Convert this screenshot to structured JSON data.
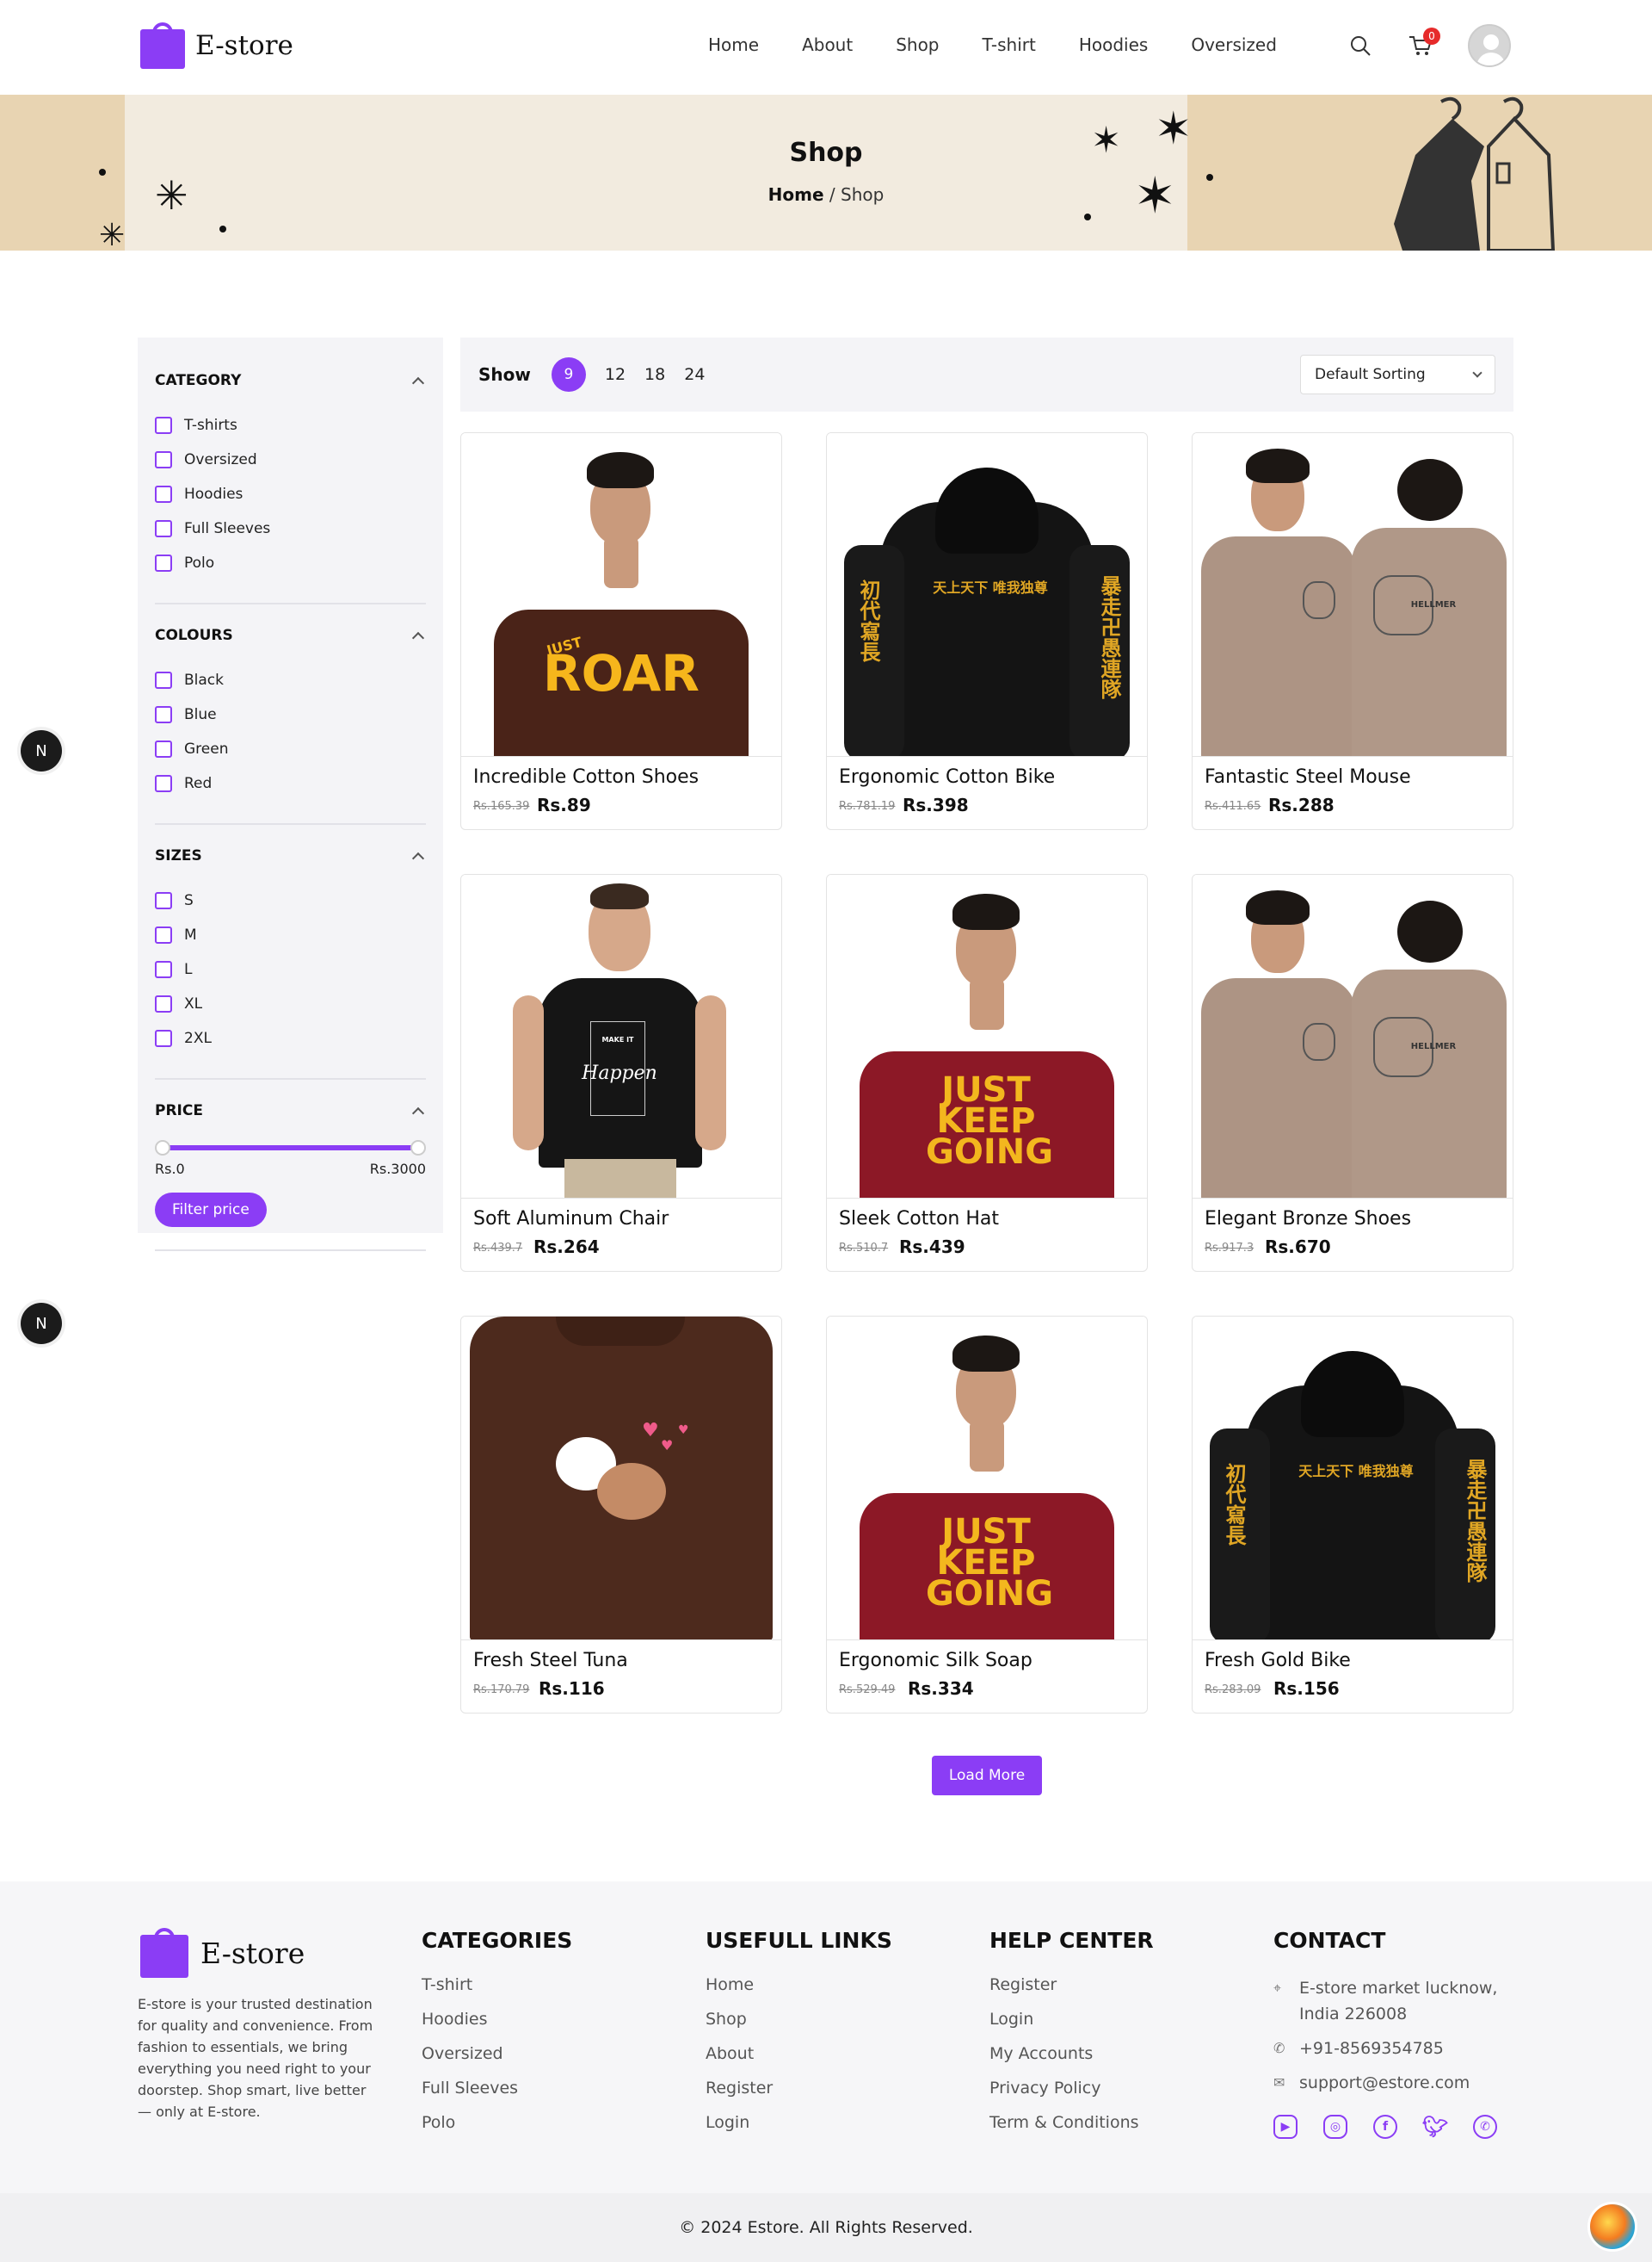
{
  "header": {
    "brand": "E-store",
    "nav": [
      "Home",
      "About",
      "Shop",
      "T-shirt",
      "Hoodies",
      "Oversized"
    ],
    "cart_count": "0",
    "icons": [
      "search-icon",
      "cart-icon",
      "user-avatar"
    ]
  },
  "banner": {
    "title": "Shop",
    "crumb_home": "Home",
    "crumb_sep": "/",
    "crumb_current": "Shop"
  },
  "filters": {
    "category": {
      "title": "CATEGORY",
      "items": [
        "T-shirts",
        "Oversized",
        "Hoodies",
        "Full Sleeves",
        "Polo"
      ]
    },
    "colours": {
      "title": "COLOURS",
      "items": [
        "Black",
        "Blue",
        "Green",
        "Red"
      ]
    },
    "sizes": {
      "title": "SIZES",
      "items": [
        "S",
        "M",
        "L",
        "XL",
        "2XL"
      ]
    },
    "price": {
      "title": "PRICE",
      "min_label": "Rs.0",
      "max_label": "Rs.3000",
      "button": "Filter price"
    }
  },
  "toolbar": {
    "show_label": "Show",
    "per_page": [
      "9",
      "12",
      "18",
      "24"
    ],
    "sort": "Default Sorting"
  },
  "products": [
    {
      "name": "Incredible Cotton Shoes",
      "old": "Rs.165.39",
      "price": "Rs.89"
    },
    {
      "name": "Ergonomic Cotton Bike",
      "old": "Rs.781.19",
      "price": "Rs.398"
    },
    {
      "name": "Fantastic Steel Mouse",
      "old": "Rs.411.65",
      "price": "Rs.288"
    },
    {
      "name": "Soft Aluminum Chair",
      "old": "Rs.439.7",
      "price": "Rs.264"
    },
    {
      "name": "Sleek Cotton Hat",
      "old": "Rs.510.7",
      "price": "Rs.439"
    },
    {
      "name": "Elegant Bronze Shoes",
      "old": "Rs.917.3",
      "price": "Rs.670"
    },
    {
      "name": "Fresh Steel Tuna",
      "old": "Rs.170.79",
      "price": "Rs.116"
    },
    {
      "name": "Ergonomic Silk Soap",
      "old": "Rs.529.49",
      "price": "Rs.334"
    },
    {
      "name": "Fresh Gold Bike",
      "old": "Rs.283.09",
      "price": "Rs.156"
    }
  ],
  "artwork": {
    "roar_top": "JUST",
    "roar_main": "ROAR",
    "hoodie_chest": "天上天下  唯我独尊",
    "hoodie_left_sleeve": "初代寫長",
    "hoodie_right_sleeve": "暴走卍愚連隊",
    "tiger_text": "HELLMER",
    "make_it": "MAKE IT",
    "happen": "Happen",
    "keep_going": "JUST KEEP GOING"
  },
  "load_more": "Load More",
  "dev_badge": "N",
  "footer": {
    "brand": "E-store",
    "about": "E-store is your trusted destination for quality and convenience. From fashion to essentials, we bring everything you need right to your doorstep. Shop smart, live better — only at E-store.",
    "categories": {
      "title": "CATEGORIES",
      "items": [
        "T-shirt",
        "Hoodies",
        "Oversized",
        "Full Sleeves",
        "Polo"
      ]
    },
    "links": {
      "title": "USEFULL LINKS",
      "items": [
        "Home",
        "Shop",
        "About",
        "Register",
        "Login"
      ]
    },
    "help": {
      "title": "HELP CENTER",
      "items": [
        "Register",
        "Login",
        "My Accounts",
        "Privacy Policy",
        "Term & Conditions"
      ]
    },
    "contact": {
      "title": "CONTACT",
      "address": "E-store market lucknow, India 226008",
      "phone": "+91-8569354785",
      "email": "support@estore.com"
    },
    "socials": [
      "youtube-icon",
      "instagram-icon",
      "facebook-icon",
      "twitter-icon",
      "whatsapp-icon"
    ],
    "copyright": "© 2024 Estore. All Rights Reserved."
  },
  "colors": {
    "accent": "#8b3df5",
    "banner": "#f2ebdf",
    "badge": "#e62b2b"
  }
}
